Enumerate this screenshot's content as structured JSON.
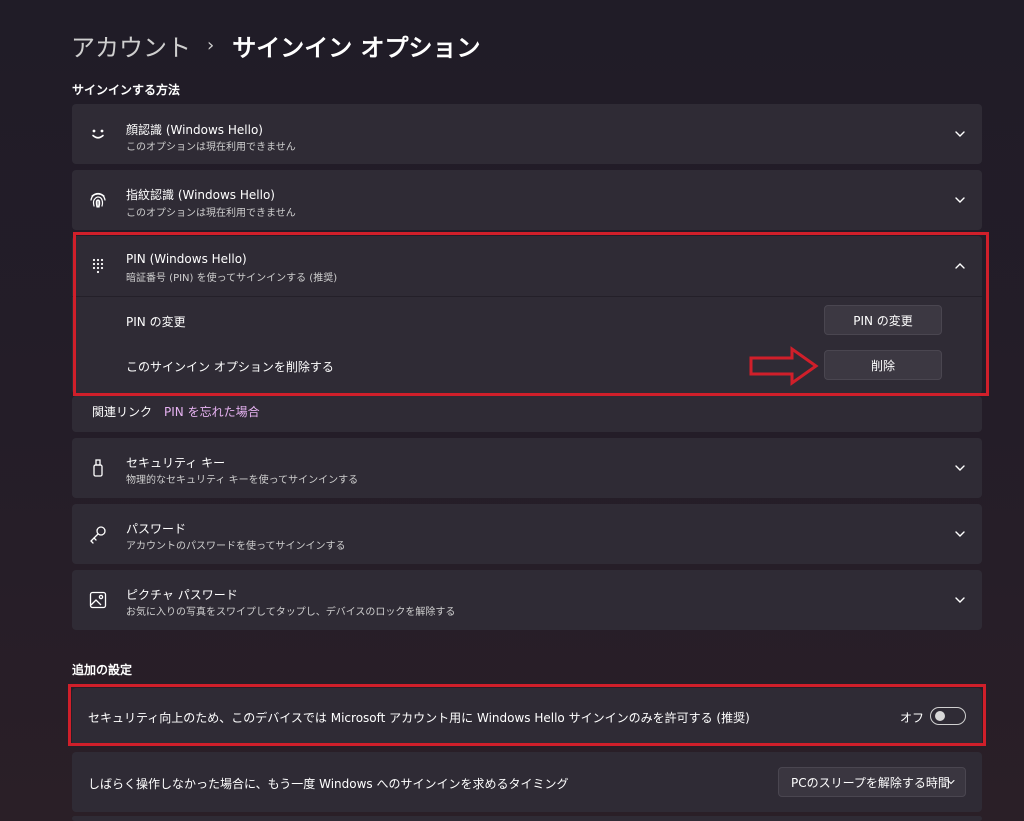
{
  "breadcrumb": {
    "parent": "アカウント",
    "separator": "›",
    "current": "サインイン オプション"
  },
  "signin_methods": {
    "heading": "サインインする方法",
    "face": {
      "title": "顔認識 (Windows Hello)",
      "subtitle": "このオプションは現在利用できません",
      "icon": "smiley-face-icon"
    },
    "fingerprint": {
      "title": "指紋認識 (Windows Hello)",
      "subtitle": "このオプションは現在利用できません",
      "icon": "fingerprint-icon"
    },
    "pin": {
      "title": "PIN (Windows Hello)",
      "subtitle": "暗証番号 (PIN) を使ってサインインする (推奨)",
      "icon": "keypad-dots-icon",
      "expanded": true,
      "change_label": "PIN の変更",
      "change_button": "PIN の変更",
      "remove_label": "このサインイン オプションを削除する",
      "remove_button": "削除"
    },
    "related": {
      "label": "関連リンク",
      "link": "PIN を忘れた場合"
    },
    "security_key": {
      "title": "セキュリティ キー",
      "subtitle": "物理的なセキュリティ キーを使ってサインインする",
      "icon": "usb-key-icon"
    },
    "password": {
      "title": "パスワード",
      "subtitle": "アカウントのパスワードを使ってサインインする",
      "icon": "key-icon"
    },
    "picture_password": {
      "title": "ピクチャ パスワード",
      "subtitle": "お気に入りの写真をスワイプしてタップし、デバイスのロックを解除する",
      "icon": "picture-icon"
    }
  },
  "additional": {
    "heading": "追加の設定",
    "hello_only": {
      "text": "セキュリティ向上のため、このデバイスでは Microsoft アカウント用に Windows Hello サインインのみを許可する (推奨)",
      "state_label": "オフ",
      "on": false
    },
    "timing": {
      "text": "しばらく操作しなかった場合に、もう一度 Windows へのサインインを求めるタイミング",
      "selected": "PCのスリープを解除する時間"
    }
  },
  "colors": {
    "accent_red": "#d01f2a",
    "link": "#e7b3f2",
    "background": "#221d27",
    "card": "#2f2b35"
  }
}
